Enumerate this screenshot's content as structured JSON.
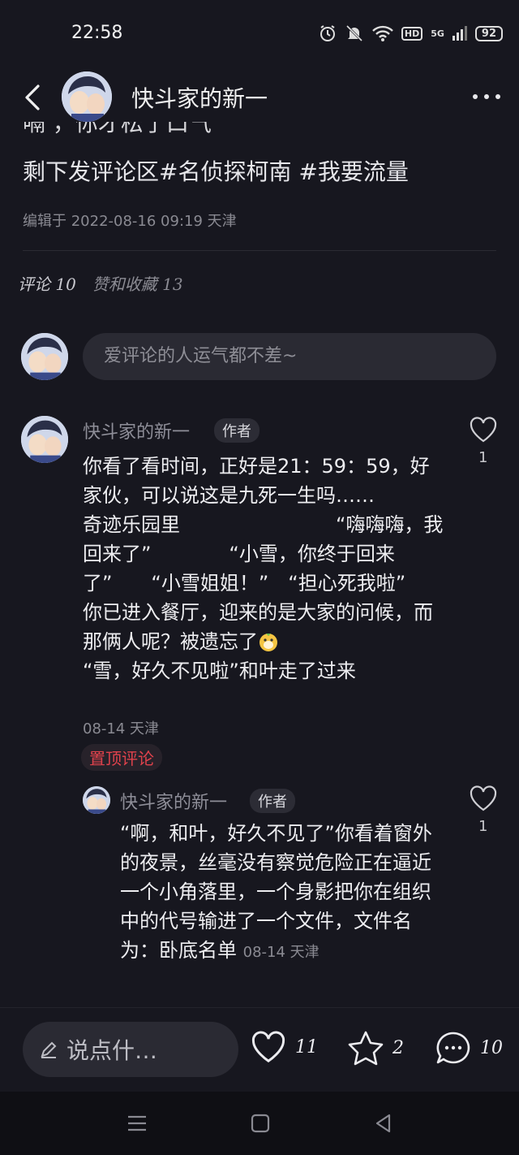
{
  "status": {
    "time": "22:58",
    "network": "5G",
    "hd": "HD",
    "battery": "92"
  },
  "header": {
    "title": "快斗家的新一"
  },
  "post": {
    "clipped_line": "嗝  ，你才松了口气",
    "last_line_prefix": "剩下发评论区",
    "tags": [
      "#名侦探柯南",
      "#我要流量"
    ],
    "edited": "编辑于 2022-08-16 09:19 天津"
  },
  "tabs": {
    "comments_label": "评论",
    "comments_count": "10",
    "likes_label": "赞和收藏",
    "likes_count": "13"
  },
  "comment_box": {
    "placeholder": "爱评论的人运气都不差~"
  },
  "comments": [
    {
      "author": "快斗家的新一",
      "badge": "作者",
      "body_before_emoji": "你看了看时间，正好是21：59：59，好家伙，可以说这是九死一生吗……\n奇迹乐园里　　　　　　　　“嗨嗨嗨，我回来了”　　　　“小雪，你终于回来了”　　“小雪姐姐！”　“担心死我啦”　　　　　　你已进入餐厅，迎来的是大家的问候，而那俩人呢？被遗忘了",
      "body_after_emoji": "\n“雪，好久不见啦”和叶走了过来",
      "meta": "08-14 天津",
      "pinned": "置顶评论",
      "likes": "1"
    }
  ],
  "reply": {
    "author": "快斗家的新一",
    "badge": "作者",
    "body": "“啊，和叶，好久不见了”你看着窗外的夜景，丝毫没有察觉危险正在逼近\n一个小角落里，一个身影把你在组织中的代号输进了一个文件，文件名为：卧底名单",
    "meta": "08-14 天津",
    "likes": "1"
  },
  "bottom": {
    "say_label": "说点什…",
    "likes": "11",
    "favorites": "2",
    "comments": "10"
  },
  "colors": {
    "background": "#17171f",
    "pinned": "#e0424c",
    "input": "#2a2a33"
  }
}
